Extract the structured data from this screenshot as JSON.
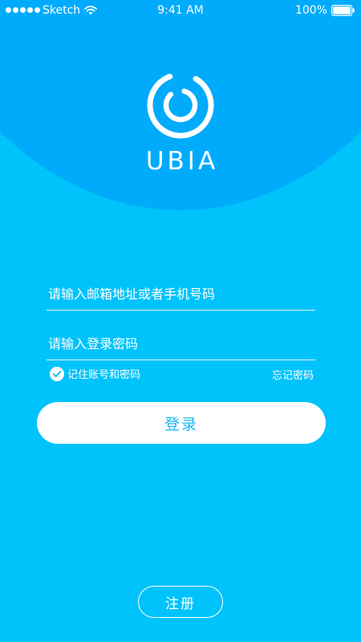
{
  "status_bar": {
    "carrier": "Sketch",
    "time": "9:41 AM",
    "battery": "100%",
    "icons": [
      "signal-dots-icon",
      "wifi-icon",
      "battery-icon"
    ]
  },
  "brand": {
    "name": "UBIA",
    "icon": "ubia-logo-icon"
  },
  "login_form": {
    "email_placeholder": "请输入邮箱地址或者手机号码",
    "email_value": "",
    "password_placeholder": "请输入登录密码",
    "password_value": "",
    "remember_label": "记住账号和密码",
    "remember_checked": true,
    "forgot_label": "忘记密码",
    "login_label": "登录"
  },
  "register_label": "注册",
  "colors": {
    "background": "#00C3FB",
    "header_arc": "#00ABFB",
    "accent_text": "#18B8F4",
    "white": "#FFFFFF"
  }
}
